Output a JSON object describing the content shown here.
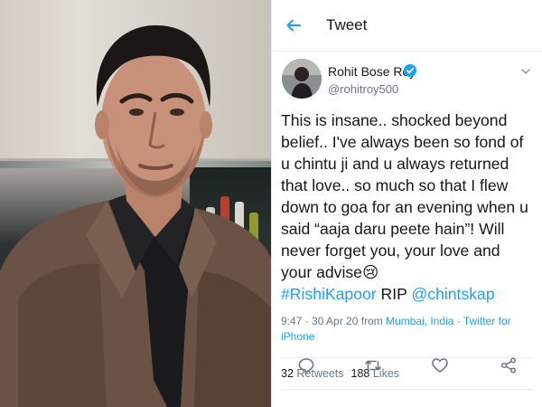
{
  "header": {
    "title": "Tweet",
    "back_icon": "arrow-left-icon"
  },
  "author": {
    "display_name": "Rohit Bose Roy",
    "handle": "@rohitroy500",
    "verified_icon": "verified-badge-icon"
  },
  "tweet": {
    "text_main": "This is insane.. shocked beyond belief.. I've always been so fond of u chintu ji and u always returned that love.. so much so that I flew down to goa for an evening when u said “aaja daru peete hain”! Will never forget you, your love and your advise",
    "emoji": "😢",
    "hashtag": "#RishiKapoor",
    "text_rip": " RIP ",
    "mention": "@chintskap"
  },
  "meta": {
    "time": "9:47 · 30 Apr 20 from ",
    "location": "Mumbai, India",
    "separator": " · ",
    "source": "Twitter for iPhone"
  },
  "stats": {
    "retweets_count": "32",
    "retweets_label": "Retweets",
    "likes_count": "188",
    "likes_label": "Likes"
  },
  "colors": {
    "accent": "#1da1f2",
    "text": "#14171a",
    "muted": "#657786"
  }
}
